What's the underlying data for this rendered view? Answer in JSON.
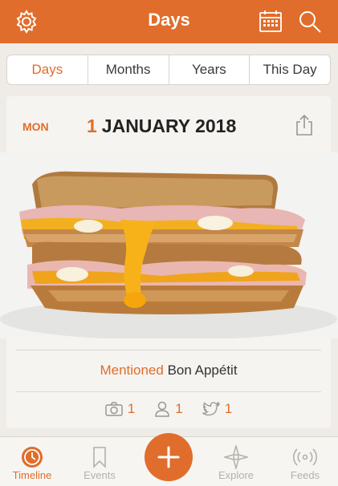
{
  "header": {
    "title": "Days",
    "icons": [
      "gear-icon",
      "calendar-icon",
      "search-icon"
    ]
  },
  "tabs": [
    {
      "label": "Days",
      "active": true
    },
    {
      "label": "Months",
      "active": false
    },
    {
      "label": "Years",
      "active": false
    },
    {
      "label": "This Day",
      "active": false
    }
  ],
  "entry": {
    "weekday": "MON",
    "day": "1",
    "month_year": "JANUARY 2018",
    "mention_label": "Mentioned",
    "mention_source": "Bon Appétit",
    "stats": {
      "photos": "1",
      "people": "1",
      "tweets": "1"
    }
  },
  "tabbar": {
    "timeline": "Timeline",
    "events": "Events",
    "explore": "Explore",
    "feeds": "Feeds"
  },
  "colors": {
    "accent": "#e06d2b",
    "background": "#efece7",
    "inactive": "#b4b0aa"
  }
}
